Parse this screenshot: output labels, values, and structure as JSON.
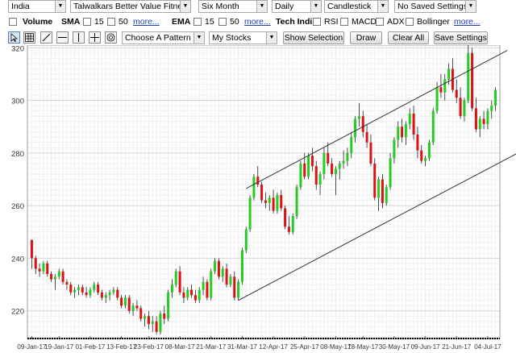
{
  "toolbar_row1": {
    "country": "India",
    "stock": "Talwalkars Better Value Fitness l",
    "period": "Six Month",
    "interval": "Daily",
    "chart_style": "Candlestick",
    "saved_settings": "No Saved Settings"
  },
  "toolbar_row2": {
    "volume_label": "Volume",
    "sma_label": "SMA",
    "sma_15": "15",
    "sma_50": "50",
    "sma_more": "more...",
    "ema_label": "EMA",
    "ema_15": "15",
    "ema_50": "50",
    "ema_more": "more...",
    "tech_label": "Tech Indi",
    "rsi": "RSI",
    "macd": "MACD",
    "adx": "ADX",
    "bollinger": "Bollinger",
    "tech_more": "more..."
  },
  "toolbar_row3": {
    "tools": [
      "pointer-icon",
      "grid-icon",
      "trendline-icon",
      "horizontal-line-icon",
      "vertical-line-icon",
      "crosshair-icon",
      "fibonacci-icon"
    ],
    "pattern_select": "Choose A Pattern",
    "mystocks_select": "My Stocks",
    "show_selection": "Show Selection",
    "draw": "Draw",
    "clear_all": "Clear All",
    "save_settings": "Save Settings"
  },
  "colors": {
    "up": "#22cc22",
    "down": "#dd1111",
    "grid": "#dcdcdc",
    "trend": "#333333"
  },
  "chart_data": {
    "type": "candlestick",
    "y_ticks": [
      "320",
      "300",
      "280",
      "260",
      "240",
      "220"
    ],
    "y_values": [
      320,
      300,
      280,
      260,
      240,
      220
    ],
    "ylim": [
      209.5,
      321
    ],
    "x_labels": [
      "09-Jan-17",
      "19-Jan-17",
      "01-Feb-17",
      "13-Feb-17",
      "23-Feb-17",
      "08-Mar-17",
      "21-Mar-17",
      "31-Mar-17",
      "12-Apr-17",
      "25-Apr-17",
      "08-May-17",
      "18-May-17",
      "30-May-17",
      "09-Jun-17",
      "21-Jun-17",
      "04-Jul-17"
    ],
    "x_label_index": [
      0,
      7,
      15,
      23,
      30,
      38,
      46,
      54,
      62,
      70,
      78,
      85,
      93,
      101,
      109,
      117
    ],
    "candles": [
      [
        247,
        244,
        236,
        240
      ],
      [
        240,
        241,
        234,
        236
      ],
      [
        236,
        238,
        233,
        235
      ],
      [
        235,
        239,
        234,
        238
      ],
      [
        238,
        239,
        233,
        234
      ],
      [
        234,
        235,
        231,
        232
      ],
      [
        232,
        234,
        228,
        233
      ],
      [
        233,
        236,
        232,
        235
      ],
      [
        235,
        236,
        230,
        231
      ],
      [
        231,
        232,
        228,
        230
      ],
      [
        230,
        231,
        226,
        227
      ],
      [
        227,
        229,
        225,
        228
      ],
      [
        228,
        230,
        226,
        229
      ],
      [
        229,
        230,
        226,
        227
      ],
      [
        227,
        229,
        225,
        226
      ],
      [
        226,
        229,
        225,
        228
      ],
      [
        228,
        231,
        227,
        230
      ],
      [
        230,
        231,
        226,
        227
      ],
      [
        227,
        228,
        224,
        225
      ],
      [
        225,
        227,
        223,
        226
      ],
      [
        226,
        228,
        224,
        227
      ],
      [
        227,
        229,
        226,
        228
      ],
      [
        228,
        229,
        224,
        225
      ],
      [
        225,
        226,
        221,
        222
      ],
      [
        222,
        226,
        221,
        225
      ],
      [
        225,
        226,
        219,
        220
      ],
      [
        220,
        223,
        218,
        222
      ],
      [
        222,
        224,
        220,
        221
      ],
      [
        221,
        222,
        216,
        217
      ],
      [
        217,
        219,
        214,
        218
      ],
      [
        218,
        220,
        213,
        215
      ],
      [
        215,
        218,
        212,
        216
      ],
      [
        216,
        218,
        211,
        212
      ],
      [
        212,
        220,
        211,
        219
      ],
      [
        219,
        222,
        215,
        217
      ],
      [
        217,
        228,
        216,
        227
      ],
      [
        227,
        232,
        225,
        230
      ],
      [
        230,
        236,
        229,
        235
      ],
      [
        235,
        237,
        226,
        227
      ],
      [
        227,
        229,
        223,
        225
      ],
      [
        225,
        229,
        224,
        228
      ],
      [
        228,
        230,
        225,
        226
      ],
      [
        226,
        228,
        223,
        224
      ],
      [
        224,
        229,
        223,
        228
      ],
      [
        228,
        233,
        226,
        231
      ],
      [
        231,
        232,
        224,
        225
      ],
      [
        225,
        236,
        224,
        235
      ],
      [
        235,
        240,
        234,
        239
      ],
      [
        239,
        240,
        232,
        233
      ],
      [
        233,
        237,
        231,
        236
      ],
      [
        236,
        238,
        229,
        230
      ],
      [
        230,
        234,
        229,
        233
      ],
      [
        233,
        235,
        224,
        225
      ],
      [
        225,
        232,
        224,
        231
      ],
      [
        231,
        244,
        230,
        243
      ],
      [
        243,
        252,
        242,
        251
      ],
      [
        251,
        264,
        250,
        263
      ],
      [
        263,
        272,
        262,
        271
      ],
      [
        271,
        275,
        267,
        268
      ],
      [
        268,
        269,
        261,
        262
      ],
      [
        262,
        265,
        259,
        261
      ],
      [
        261,
        264,
        258,
        263
      ],
      [
        263,
        266,
        257,
        258
      ],
      [
        258,
        265,
        257,
        264
      ],
      [
        264,
        266,
        258,
        259
      ],
      [
        259,
        260,
        251,
        252
      ],
      [
        252,
        256,
        249,
        250
      ],
      [
        250,
        257,
        249,
        256
      ],
      [
        256,
        268,
        255,
        267
      ],
      [
        267,
        277,
        266,
        276
      ],
      [
        276,
        280,
        270,
        271
      ],
      [
        271,
        280,
        270,
        279
      ],
      [
        279,
        282,
        273,
        275
      ],
      [
        275,
        277,
        266,
        268
      ],
      [
        268,
        273,
        264,
        272
      ],
      [
        272,
        282,
        270,
        280
      ],
      [
        280,
        284,
        275,
        276
      ],
      [
        276,
        278,
        271,
        272
      ],
      [
        272,
        275,
        264,
        274
      ],
      [
        274,
        277,
        270,
        276
      ],
      [
        276,
        281,
        274,
        277
      ],
      [
        277,
        282,
        275,
        280
      ],
      [
        280,
        288,
        278,
        286
      ],
      [
        286,
        294,
        284,
        293
      ],
      [
        293,
        299,
        290,
        294
      ],
      [
        294,
        296,
        286,
        288
      ],
      [
        288,
        291,
        282,
        284
      ],
      [
        284,
        287,
        275,
        276
      ],
      [
        276,
        278,
        262,
        263
      ],
      [
        263,
        271,
        258,
        270
      ],
      [
        270,
        272,
        259,
        261
      ],
      [
        261,
        268,
        260,
        267
      ],
      [
        267,
        280,
        266,
        278
      ],
      [
        278,
        286,
        276,
        285
      ],
      [
        285,
        292,
        282,
        290
      ],
      [
        290,
        293,
        284,
        286
      ],
      [
        286,
        292,
        283,
        291
      ],
      [
        291,
        297,
        289,
        295
      ],
      [
        295,
        298,
        285,
        287
      ],
      [
        287,
        290,
        278,
        281
      ],
      [
        281,
        283,
        276,
        277
      ],
      [
        277,
        279,
        275,
        278
      ],
      [
        278,
        285,
        277,
        284
      ],
      [
        284,
        297,
        283,
        296
      ],
      [
        296,
        307,
        295,
        305
      ],
      [
        305,
        310,
        301,
        303
      ],
      [
        303,
        310,
        300,
        308
      ],
      [
        308,
        314,
        306,
        312
      ],
      [
        312,
        316,
        303,
        304
      ],
      [
        304,
        308,
        299,
        301
      ],
      [
        301,
        305,
        293,
        294
      ],
      [
        294,
        301,
        292,
        300
      ],
      [
        300,
        321,
        299,
        318
      ],
      [
        318,
        320,
        296,
        297
      ],
      [
        297,
        301,
        288,
        289
      ],
      [
        289,
        294,
        286,
        293
      ],
      [
        293,
        296,
        289,
        291
      ],
      [
        291,
        297,
        289,
        296
      ],
      [
        296,
        300,
        293,
        298
      ],
      [
        298,
        305,
        296,
        304
      ]
    ],
    "trendlines": [
      {
        "from": [
          55,
          266.5
        ],
        "to": [
          122,
          319
        ]
      },
      {
        "from": [
          53,
          224
        ],
        "to": [
          126,
          281
        ]
      }
    ]
  }
}
